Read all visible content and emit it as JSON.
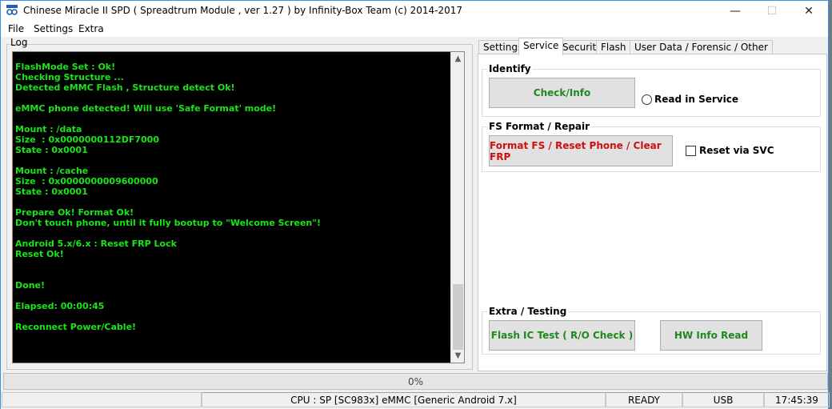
{
  "window": {
    "title": "Chinese Miracle II SPD ( Spreadtrum Module , ver 1.27 ) by Infinity-Box Team (c) 2014-2017",
    "min_glyph": "—",
    "max_glyph": "☐",
    "close_glyph": "✕"
  },
  "menu": [
    "File",
    "Settings",
    "Extra"
  ],
  "log": {
    "label": "Log",
    "lines": [
      "FlashMode Set : Ok!",
      "Checking Structure ...",
      "Detected eMMC Flash , Structure detect Ok!",
      "",
      "eMMC phone detected! Will use 'Safe Format' mode!",
      "",
      "Mount : /data",
      "Size  : 0x0000000112DF7000",
      "State : 0x0001",
      "",
      "Mount : /cache",
      "Size  : 0x0000000009600000",
      "State : 0x0001",
      "",
      "Prepare Ok! Format Ok!",
      "Don't touch phone, until it fully bootup to \"Welcome Screen\"!",
      "",
      "Android 5.x/6.x : Reset FRP Lock",
      "Reset Ok!",
      "",
      "",
      "Done!",
      "",
      "Elapsed: 00:00:45",
      "",
      "Reconnect Power/Cable!"
    ],
    "text_color": "#19e619",
    "background": "#000000"
  },
  "tabs": [
    "Settings",
    "Service",
    "Security",
    "Flash",
    "User Data / Forensic / Other"
  ],
  "active_tab": "Service",
  "service": {
    "identify": {
      "title": "Identify",
      "check_info_label": "Check/Info",
      "read_in_service_label": "Read in Service"
    },
    "fs_format": {
      "title": "FS Format / Repair",
      "format_button_label": "Format FS / Reset Phone / Clear FRP",
      "reset_via_svc_label": "Reset via SVC"
    },
    "extra": {
      "title": "Extra / Testing",
      "flash_ic_test_label": "Flash IC Test ( R/O Check )",
      "hw_info_label": "HW Info Read"
    }
  },
  "progress": {
    "value": 0,
    "text": "0%"
  },
  "status": {
    "cpu": "CPU : SP [SC983x] eMMC [Generic Android 7.x]",
    "state": "READY",
    "connection": "USB",
    "time": "17:45:39"
  },
  "colors": {
    "accent_green": "#1d8a1d",
    "accent_red": "#d01010",
    "log_green": "#19e619"
  }
}
